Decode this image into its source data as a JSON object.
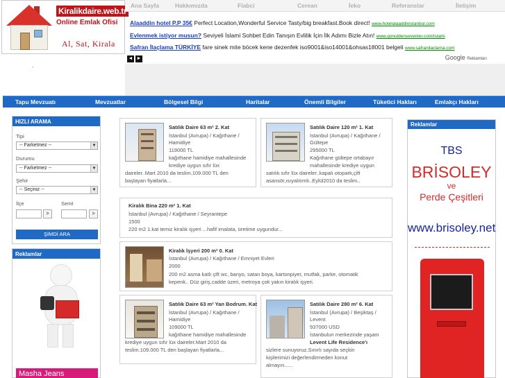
{
  "logo": {
    "title": "Kiralikdaire.web.tr",
    "subtitle": "Online Emlak Ofisi",
    "slogan": "Al, Sat, Kirala"
  },
  "topnav": [
    "Ana Sayfa",
    "Hakkımızda",
    "Fiabci",
    "Cerean",
    "İeko",
    "Referanslar",
    "İletişim"
  ],
  "ads": {
    "lines": [
      {
        "title": "Alaaddin hotel P.P 35€",
        "text": "Perfect Location,Wonderful Service Tasty/big breakfast.Book direct!",
        "url": "www.hotelalaaddinistanbul.com"
      },
      {
        "title": "Evlenmek istiyor musun?",
        "text": "Seviyeli İslami Sohbet Edin Tanışın Evlilik İçin İlk Adımı Bizle Atın!",
        "url": "www.gonuldensevenler.com/islami"
      },
      {
        "title": "Safran İlaçlama TÜRKİYE",
        "text": "fare sinek mite böcek kene dezenfek iso9001&iso14001&ohsas18001 belgeli",
        "url": "www.safranilaclama.com"
      }
    ],
    "google": "Google",
    "google_sub": "Reklamları",
    "prev": "◄",
    "next": "►"
  },
  "stray_dot": "·",
  "mainnav": [
    "Tapu Mevzuatı",
    "Mevzuatlar",
    "Bölgesel Bilgi",
    "Haritalar",
    "Önemli Bilgiler",
    "Tüketici Hakları",
    "Emlakçı Hakları"
  ],
  "search": {
    "title": "HIZLI ARAMA",
    "tip_label": "Tipi",
    "tip_value": "-- Farketmez --",
    "durum_label": "Durumu",
    "durum_value": "-- Farketmez --",
    "sehir_label": "Şehir",
    "sehir_value": "-- Seçiniz --",
    "ilce_label": "İlçe",
    "semt_label": "Semt",
    "go": ">",
    "button": "ŞİMDİ ARA",
    "arrow": "▼"
  },
  "left_ads": {
    "title": "Reklamlar",
    "masha": "Masha  Jeans"
  },
  "listings": [
    {
      "title": "Satılık Daire 63 m² 2. Kat",
      "loc": "İstanbul (Avrupa) / Kağıthane /",
      "loc2": "Hamidiye",
      "price": "119000 TL",
      "d1": "kağıthane hamidiye mahallesinde",
      "d2": "krediye uygun sıfır lüx",
      "d3": "daireler..Mart 2010 da teslim.109.000 TL den",
      "d4": "başlayan fiyatlarla..."
    },
    {
      "title": "Satılık Daire 120 m² 1. Kat",
      "loc": "İstanbul (Avrupa) / Kağıthane /",
      "loc2": "Gültepe",
      "price": "295000 TL",
      "d1": "Kağıthane gültepe ortabayır",
      "d2": "mahallesinde krediye uygun",
      "d3": "satılık sıfır lüx daireler..kapalı otopark,çift",
      "d4": "asansör,ısıyalıtımlı..Eylül2010 da teslim.."
    },
    {
      "title": "Kiralık Bina 220 m² 1. Kat",
      "loc": "İstanbul (Avrupa) / Kağıthane / Seyrantepe",
      "price": "1500",
      "d1": "220 m2 1.kat temiz kiralık işyeri ...hafif imalata, üretime uygundur..."
    },
    {
      "title": "Kiralık İşyeri 200 m² 0. Kat",
      "loc": "İstanbul (Avrupa) / Kağıthane / Emniyet Evleri",
      "price": "2000",
      "d1": "200 m2 asma katlı çift wc, banyo, satan boya, kartonpiyer, mutfak, parke, otomatik",
      "d2": "kepenk.. Düz giriş,cadde üzeri, metroya çok yakın kiralık işyeri."
    },
    {
      "title": "Satılık Daire 63 m² Yan Bodrum. Kat",
      "loc": "İstanbul (Avrupa) / Kağıthane /",
      "loc2": "Hamidiye",
      "price": "109000 TL",
      "d1": "kağıthane hamidiye mahallesinde",
      "d2": "krediye uygun sıfır lüx daireler.Mart 2010 da",
      "d3": "teslim.109.000 TL den başlayan fiyatlarla..."
    },
    {
      "title": "Satılık Daire 280 m² 6. Kat",
      "loc": "İstanbul (Avrupa) / Beşiktaş /",
      "loc2": "Levent",
      "price": "937000 USD",
      "d1": "İstanbulun merkezinde yaşam",
      "d2": "Levent Life Residence'ı",
      "d3": "sizlere sunuyoruz.Sınırlı sayıda seçkin",
      "d4": "kişilerimizi değerlendirmeden konut",
      "d5": "almayın......"
    }
  ],
  "right_ads": {
    "title": "Reklamlar",
    "tbs": "TBS",
    "brisoley": "BRİSOLEY",
    "ve": "ve",
    "perde": "Perde Çeşitleri",
    "url": "www.brisoley.net"
  },
  "colors": {
    "nav_blue": "#1f6ac4",
    "brand_red": "#c0141b",
    "ad_link": "#1a3cc2",
    "ad_url": "#008a00"
  }
}
